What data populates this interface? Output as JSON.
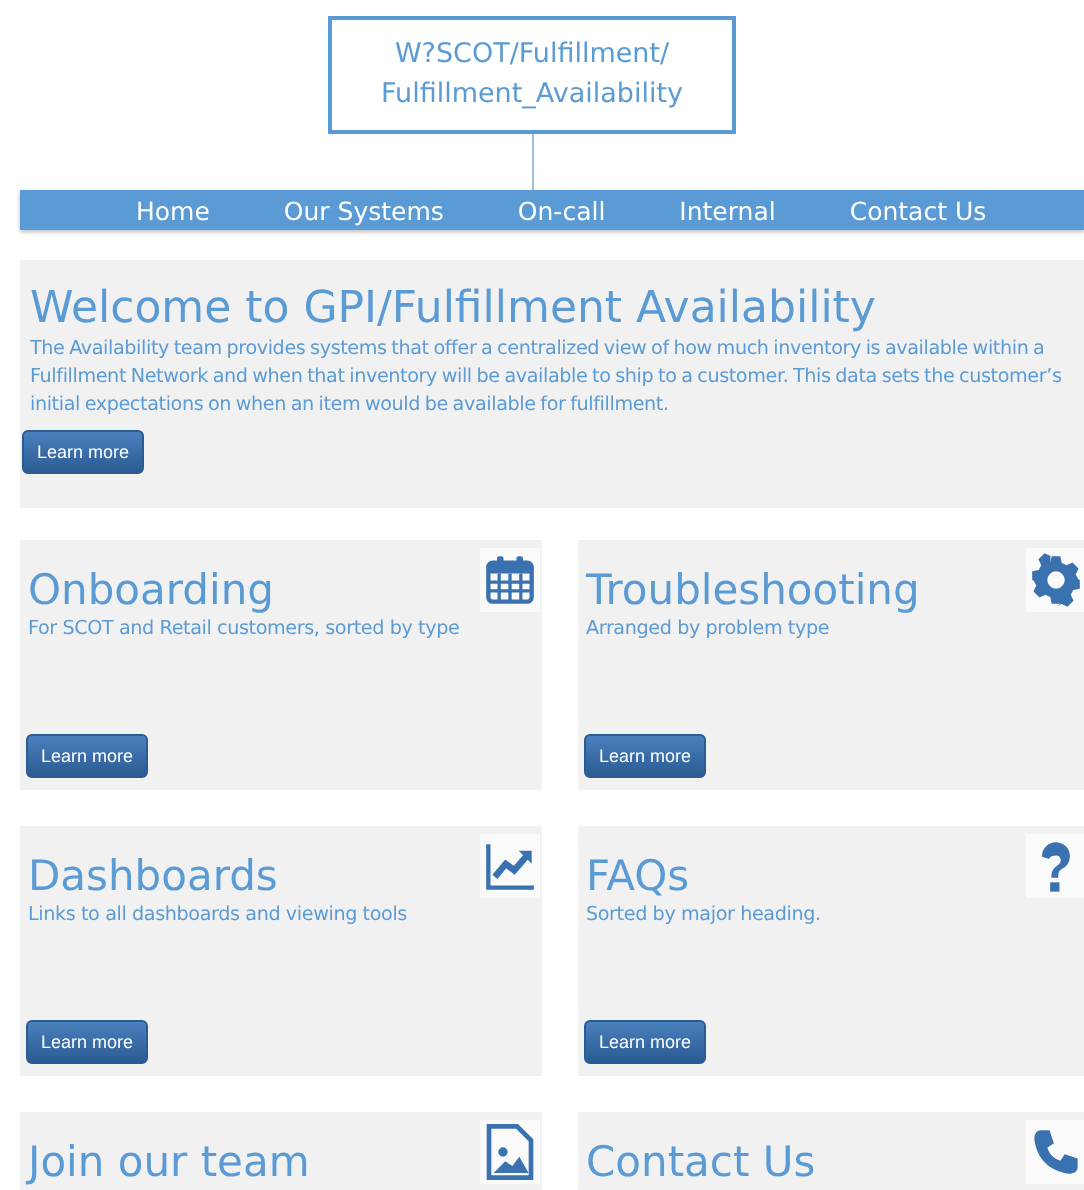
{
  "site_title": {
    "lines": [
      "W?SCOT/Fulfillment/",
      "Fulfillment_Availability"
    ]
  },
  "nav": [
    {
      "label": "Home"
    },
    {
      "label": "Our Systems"
    },
    {
      "label": "On-call"
    },
    {
      "label": "Internal"
    },
    {
      "label": "Contact Us"
    }
  ],
  "hero": {
    "title": "Welcome to GPI/Fulfillment Availability",
    "text": "The Availability team provides systems that offer a centralized view of how much inventory is available within a Fulfillment Network and when that inventory will be available to ship to a customer. This data sets the customer’s initial expectations on when an item would be available for fulfillment.",
    "button": "Learn more"
  },
  "cards": [
    {
      "title": "Onboarding",
      "text": "For SCOT and Retail customers, sorted by type",
      "button": "Learn more"
    },
    {
      "title": "Troubleshooting",
      "text": "Arranged by problem type",
      "button": "Learn more"
    },
    {
      "title": "Dashboards",
      "text": "Links to all dashboards and viewing tools",
      "button": "Learn more"
    },
    {
      "title": "FAQs",
      "text": "Sorted by major heading.",
      "button": "Learn more"
    },
    {
      "title": "Join our team"
    },
    {
      "title": "Contact Us"
    }
  ]
}
